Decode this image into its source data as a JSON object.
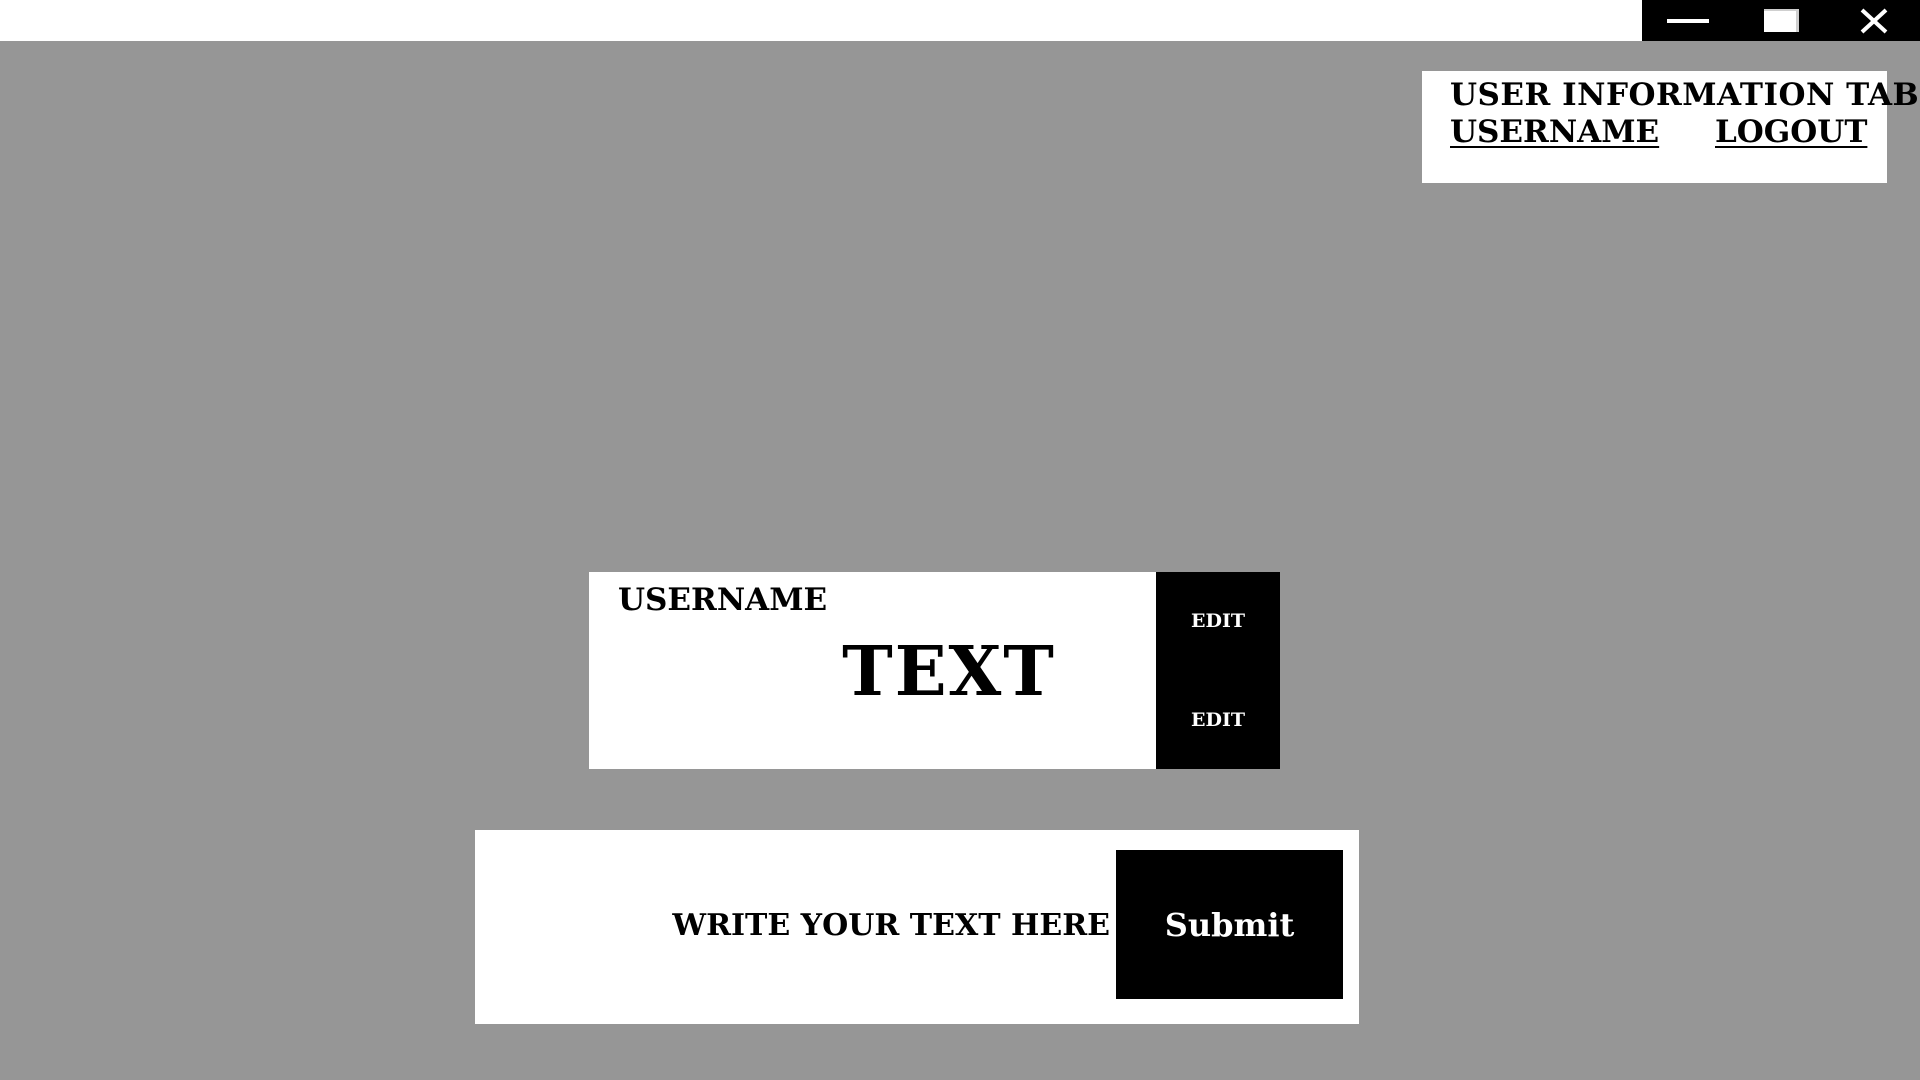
{
  "window": {
    "controls": [
      {
        "name": "minimize-icon"
      },
      {
        "name": "maximize-icon"
      },
      {
        "name": "close-icon"
      }
    ]
  },
  "user_panel": {
    "title": "USER INFORMATION TAB",
    "username_link": "USERNAME",
    "logout_link": "LOGOUT"
  },
  "post": {
    "username": "USERNAME",
    "text": "TEXT",
    "edit_label_1": "EDIT",
    "edit_label_2": "EDIT"
  },
  "compose": {
    "placeholder": "WRITE YOUR TEXT HERE",
    "submit_label": "Submit"
  },
  "colors": {
    "background": "#969696",
    "panel": "#ffffff",
    "button": "#000000",
    "button_text": "#ffffff"
  }
}
